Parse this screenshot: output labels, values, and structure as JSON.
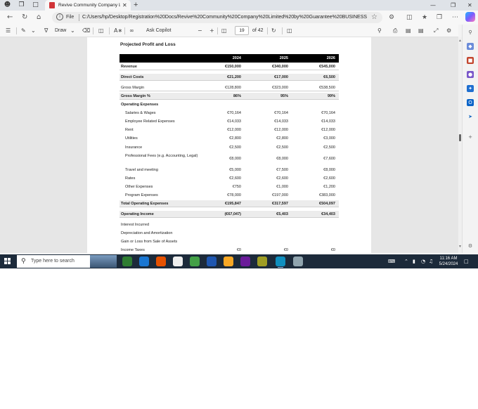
{
  "browser": {
    "tab_title": "Revive Community Company Lin",
    "address_scheme": "File",
    "url": "C:/Users/hp/Desktop/Registration%20Docs/Revive%20Community%20Company%20Limited%20by%20Guarantee%20BUSINESS%2..."
  },
  "pdf_toolbar": {
    "draw_label": "Draw",
    "ask_copilot_label": "Ask Copilot",
    "page_number": "19",
    "page_total": "of 42"
  },
  "document": {
    "title": "Projected Profit and Loss",
    "columns": [
      "2024",
      "2025",
      "2026"
    ],
    "rows": [
      {
        "label": "Revenue",
        "values": [
          "€150,000",
          "€340,000",
          "€545,000"
        ]
      },
      {
        "label": "Direct Costs",
        "values": [
          "€21,200",
          "€17,000",
          "€6,500"
        ]
      },
      {
        "label": "Gross Margin",
        "values": [
          "€128,800",
          "€323,000",
          "€538,500"
        ]
      },
      {
        "label": "Gross Margin %",
        "values": [
          "86%",
          "95%",
          "99%"
        ]
      },
      {
        "label": "Operating Expenses",
        "values": []
      },
      {
        "label": "Salaries & Wages",
        "values": [
          "€70,164",
          "€70,164",
          "€70,164"
        ]
      },
      {
        "label": "Employee Related Expenses",
        "values": [
          "€14,033",
          "€14,033",
          "€14,033"
        ]
      },
      {
        "label": "Rent",
        "values": [
          "€12,000",
          "€12,000",
          "€12,000"
        ]
      },
      {
        "label": "Utilities",
        "values": [
          "€2,800",
          "€2,800",
          "€3,000"
        ]
      },
      {
        "label": "Insurance",
        "values": [
          "€2,500",
          "€2,500",
          "€2,500"
        ]
      },
      {
        "label": "Professional Fees (e.g. Accounting, Legal)",
        "values": [
          "€8,000",
          "€8,000",
          "€7,600"
        ]
      },
      {
        "label": "Travel and meeting",
        "values": [
          "€5,000",
          "€7,500",
          "€8,000"
        ]
      },
      {
        "label": "Rates",
        "values": [
          "€2,600",
          "€2,600",
          "€2,600"
        ]
      },
      {
        "label": "Other Expenses",
        "values": [
          "€750",
          "€1,000",
          "€1,200"
        ]
      },
      {
        "label": "Program Expenses",
        "values": [
          "€78,000",
          "€197,000",
          "€383,000"
        ]
      },
      {
        "label": "Total Operating Expenses",
        "values": [
          "€195,847",
          "€317,597",
          "€504,097"
        ]
      },
      {
        "label": "Operating Income",
        "values": [
          "(€67,047)",
          "€5,403",
          "€34,403"
        ]
      },
      {
        "label": "Interest Incurred",
        "values": []
      },
      {
        "label": "Depreciation and Amortization",
        "values": []
      },
      {
        "label": "Gain or Loss from Sale of Assets",
        "values": []
      },
      {
        "label": "Income Taxes",
        "values": [
          "€0",
          "€0",
          "€0"
        ]
      }
    ]
  },
  "taskbar": {
    "search_placeholder": "Type here to search",
    "time": "11:16 AM",
    "date": "5/24/2024"
  },
  "colors": {
    "taskbar": "#1c2a3a",
    "pdf_icon": "#d13438",
    "table_header": "#000000"
  }
}
